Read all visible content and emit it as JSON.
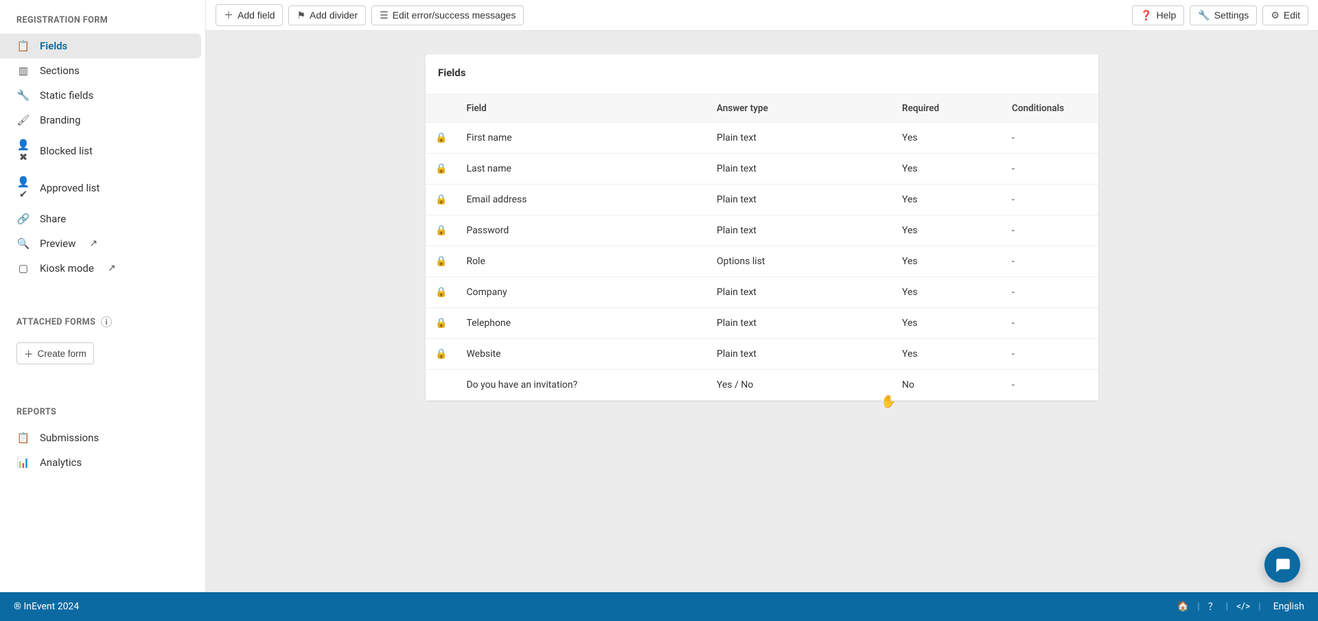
{
  "sidebar": {
    "sections": {
      "registration_form": {
        "title": "REGISTRATION FORM",
        "items": [
          {
            "id": "fields",
            "label": "Fields",
            "icon": "📋",
            "active": true
          },
          {
            "id": "sections",
            "label": "Sections",
            "icon": "▥"
          },
          {
            "id": "static-fields",
            "label": "Static fields",
            "icon": "🔧"
          },
          {
            "id": "branding",
            "label": "Branding",
            "icon": "🖌"
          },
          {
            "id": "blocked-list",
            "label": "Blocked list",
            "icon": "👤✖"
          },
          {
            "id": "approved-list",
            "label": "Approved list",
            "icon": "👤✔"
          },
          {
            "id": "share",
            "label": "Share",
            "icon": "🔗"
          },
          {
            "id": "preview",
            "label": "Preview",
            "icon": "🔍",
            "external": true
          },
          {
            "id": "kiosk-mode",
            "label": "Kiosk mode",
            "icon": "▢",
            "external": true
          }
        ]
      },
      "attached_forms": {
        "title": "ATTACHED FORMS",
        "create_label": "Create form"
      },
      "reports": {
        "title": "REPORTS",
        "items": [
          {
            "id": "submissions",
            "label": "Submissions",
            "icon": "📋"
          },
          {
            "id": "analytics",
            "label": "Analytics",
            "icon": "📊"
          }
        ]
      }
    }
  },
  "toolbar": {
    "add_field": "Add field",
    "add_divider": "Add divider",
    "edit_msgs": "Edit error/success messages",
    "help": "Help",
    "settings": "Settings",
    "edit": "Edit"
  },
  "card": {
    "title": "Fields",
    "columns": {
      "field": "Field",
      "answer_type": "Answer type",
      "required": "Required",
      "conditionals": "Conditionals"
    },
    "rows": [
      {
        "locked": true,
        "field": "First name",
        "answer": "Plain text",
        "required": "Yes",
        "conditionals": "-"
      },
      {
        "locked": true,
        "field": "Last name",
        "answer": "Plain text",
        "required": "Yes",
        "conditionals": "-"
      },
      {
        "locked": true,
        "field": "Email address",
        "answer": "Plain text",
        "required": "Yes",
        "conditionals": "-"
      },
      {
        "locked": true,
        "field": "Password",
        "answer": "Plain text",
        "required": "Yes",
        "conditionals": "-"
      },
      {
        "locked": true,
        "field": "Role",
        "answer": "Options list",
        "required": "Yes",
        "conditionals": "-"
      },
      {
        "locked": true,
        "field": "Company",
        "answer": "Plain text",
        "required": "Yes",
        "conditionals": "-"
      },
      {
        "locked": true,
        "field": "Telephone",
        "answer": "Plain text",
        "required": "Yes",
        "conditionals": "-"
      },
      {
        "locked": true,
        "field": "Website",
        "answer": "Plain text",
        "required": "Yes",
        "conditionals": "-"
      },
      {
        "locked": false,
        "field": "Do you have an invitation?",
        "answer": "Yes / No",
        "required": "No",
        "conditionals": "-"
      }
    ]
  },
  "footer": {
    "copyright": "® InEvent 2024",
    "language": "English"
  }
}
